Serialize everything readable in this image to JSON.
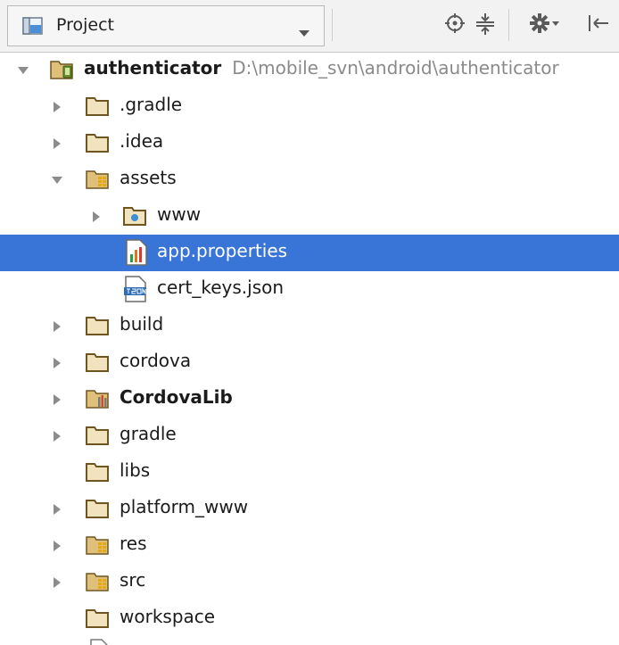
{
  "toolbar": {
    "view_label": "Project",
    "buttons": [
      "locate-icon",
      "collapse-all-icon",
      "gear-icon",
      "hide-icon"
    ]
  },
  "tree": {
    "root": {
      "name": "authenticator",
      "path": "D:\\mobile_svn\\android\\authenticator"
    },
    "items": [
      {
        "name": ".gradle"
      },
      {
        "name": ".idea"
      },
      {
        "name": "assets"
      },
      {
        "name": "www"
      },
      {
        "name": "app.properties"
      },
      {
        "name": "cert_keys.json"
      },
      {
        "name": "build"
      },
      {
        "name": "cordova"
      },
      {
        "name": "CordovaLib"
      },
      {
        "name": "gradle"
      },
      {
        "name": "libs"
      },
      {
        "name": "platform_www"
      },
      {
        "name": "res"
      },
      {
        "name": "src"
      },
      {
        "name": "workspace"
      }
    ]
  },
  "colors": {
    "selection": "#3875d7",
    "folder": "#8a6a2a",
    "path_text": "#8a8a8a"
  }
}
